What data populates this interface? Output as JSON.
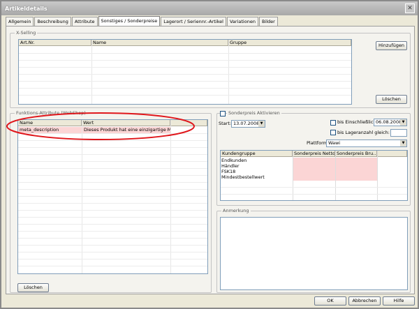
{
  "window": {
    "title": "Artikeldetails",
    "close_glyph": "✕"
  },
  "tabs": [
    "Allgemein",
    "Beschreibung",
    "Attribute",
    "Sonstiges / Sonderpreise",
    "Lagerort / Seriennr.-Artikel",
    "Variationen",
    "Bilder"
  ],
  "xselling": {
    "legend": "X-Selling",
    "columns": [
      "Art.Nr.",
      "Name",
      "Gruppe"
    ],
    "add_button": "Hinzufügen",
    "delete_button": "Löschen"
  },
  "funktions": {
    "legend": "Funktions-Attribute (WebShop)",
    "columns": [
      "Name",
      "Wert"
    ],
    "rows": [
      {
        "name": "meta_description",
        "wert": "Dieses Produkt hat eine einzigartige M..."
      }
    ],
    "delete_button": "Löschen"
  },
  "sonderpreis": {
    "activate_label": "Sonderpreis Aktivieren",
    "start_label": "Start:",
    "start_value": "13.07.2008",
    "until_label": "bis Einschließlich:",
    "until_value": "06.08.2008",
    "stock_label": "bis Lageranzahl gleich:",
    "stock_value": "",
    "platform_label": "Plattform:",
    "platform_value": "Wawi",
    "columns": [
      "Kundengruppe",
      "Sonderpreis Netto",
      "Sonderpreis Bru..."
    ],
    "groups": [
      "Endkunden",
      "Händler",
      "FSK18",
      "Mindestbestellwert"
    ]
  },
  "anmerkung": {
    "legend": "Anmerkung",
    "text": ""
  },
  "footer": {
    "ok": "OK",
    "cancel": "Abbrechen",
    "help": "Hilfe"
  },
  "colors": {
    "annotation": "#e0161b",
    "highlight_row": "#fbd5d5"
  }
}
